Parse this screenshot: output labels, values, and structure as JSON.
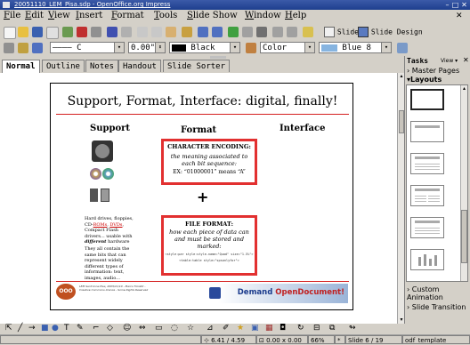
{
  "window": {
    "title": "20051110_LEM_Pisa.sdp - OpenOffice.org Impress"
  },
  "menu": [
    "File",
    "Edit",
    "View",
    "Insert",
    "Format",
    "Tools",
    "Slide Show",
    "Window",
    "Help"
  ],
  "toolbar": {
    "slide_label": "Slide",
    "slide_design_label": "Slide Design"
  },
  "format_bar": {
    "line_style": "———— C",
    "line_width": "0.00\"",
    "line_color": "Black",
    "area_fill": "Color",
    "area_color": "Blue 8"
  },
  "view_tabs": [
    "Normal",
    "Outline",
    "Notes",
    "Handout",
    "Slide Sorter"
  ],
  "active_tab": "Normal",
  "slide": {
    "title": "Support, Format, Interface: digital, finally!",
    "columns": [
      "Support",
      "Format",
      "Interface"
    ],
    "char_box": {
      "heading": "CHARACTER ENCODING:",
      "body": "the meaning associated to each bit sequence:",
      "example": "EX: “01000001” means “A”"
    },
    "plus": "+",
    "file_box": {
      "heading": "FILE FORMAT:",
      "body": "how each piece of data can and must be stored and marked:",
      "code1": "<style:par style:style-name=\"Quad\" size=\"1.5%\">",
      "code2": "<table:table style=\"spsonlyfor\">"
    },
    "support_text1_parts": [
      "Hard drives, floppies, CD-",
      "ROMs",
      ", ",
      "DVDs",
      ", Compact Flash drivers... usable with ",
      "different",
      " hardware"
    ],
    "support_text2": "They all contain the same bits that can represent widely different types of information: text, images, audio...",
    "footer_credit": "LEM Sant'Anna Pisa, 2005/11/10 - Marco Fioretti - Creative Commons licence - Some Rights Reserved",
    "footer_logo": "OOO",
    "banner_text_prefix": "Demand ",
    "banner_text_brand": "OpenDocument!"
  },
  "task_pane": {
    "title": "Tasks",
    "view_label": "View",
    "sections": {
      "master": "Master Pages",
      "layouts": "Layouts",
      "custom": "Custom Animation",
      "transition": "Slide Transition"
    }
  },
  "status": {
    "position": "6.41 / 4.59",
    "size": "0.00 x 0.00",
    "zoom": "66%",
    "slide": "Slide 6 / 19",
    "template": "odf_template"
  },
  "colors": {
    "titlebar": "#1e3f8e",
    "accent_red": "#e23030",
    "banner_blue": "#1a3a8c"
  }
}
